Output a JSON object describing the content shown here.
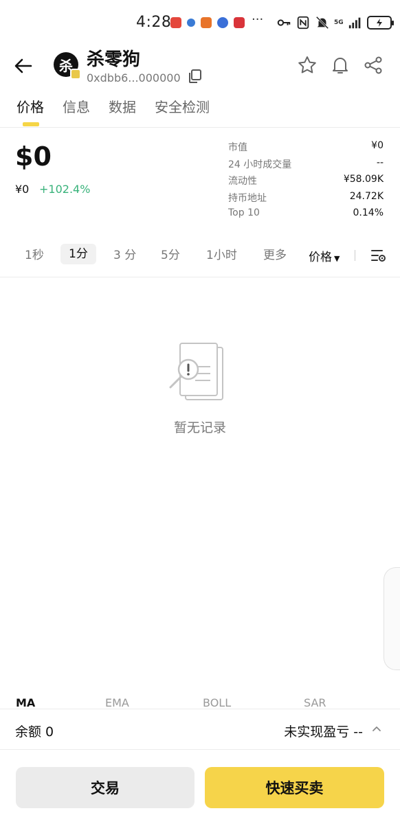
{
  "status_bar": {
    "time": "4:28",
    "more": "···",
    "network": "5G",
    "app_colors": [
      "#e4473c",
      "#3a7bd5",
      "#e8742a",
      "#3a6fd8",
      "#d9343a"
    ]
  },
  "header": {
    "back_icon": "arrow-left-icon",
    "avatar_char": "杀",
    "token_name": "杀零狗",
    "address": "0xdbb6...000000",
    "actions": [
      "star-icon",
      "bell-icon",
      "share-icon"
    ]
  },
  "tabs": [
    {
      "label": "价格",
      "active": true
    },
    {
      "label": "信息",
      "active": false
    },
    {
      "label": "数据",
      "active": false
    },
    {
      "label": "安全检测",
      "active": false
    }
  ],
  "price": {
    "main": "$0",
    "sub": "¥0",
    "change": "+102.4%",
    "change_color": "#38b27a"
  },
  "stats": [
    {
      "label": "市值",
      "value": "¥0"
    },
    {
      "label": "24 小时成交量",
      "value": "--"
    },
    {
      "label": "流动性",
      "value": "¥58.09K"
    },
    {
      "label": "持币地址",
      "value": "24.72K"
    },
    {
      "label": "Top 10",
      "value": "0.14%"
    }
  ],
  "intervals": [
    {
      "label": "1秒",
      "active": false
    },
    {
      "label": "1分",
      "active": true
    },
    {
      "label": "3 分",
      "active": false
    },
    {
      "label": "5分",
      "active": false
    },
    {
      "label": "1小时",
      "active": false
    },
    {
      "label": "更多",
      "active": false
    }
  ],
  "price_dropdown": "价格",
  "empty_state": {
    "text": "暂无记录"
  },
  "indicator_tabs": [
    {
      "label": "MA",
      "active": true
    },
    {
      "label": "EMA",
      "active": false
    },
    {
      "label": "BOLL",
      "active": false
    },
    {
      "label": "SAR",
      "active": false
    }
  ],
  "balance_bar": {
    "balance": "余额 0",
    "pnl": "未实现盈亏 --"
  },
  "buttons": {
    "trade": "交易",
    "quick_trade": "快速买卖"
  },
  "colors": {
    "accent": "#f6d44a",
    "positive": "#38b27a"
  }
}
